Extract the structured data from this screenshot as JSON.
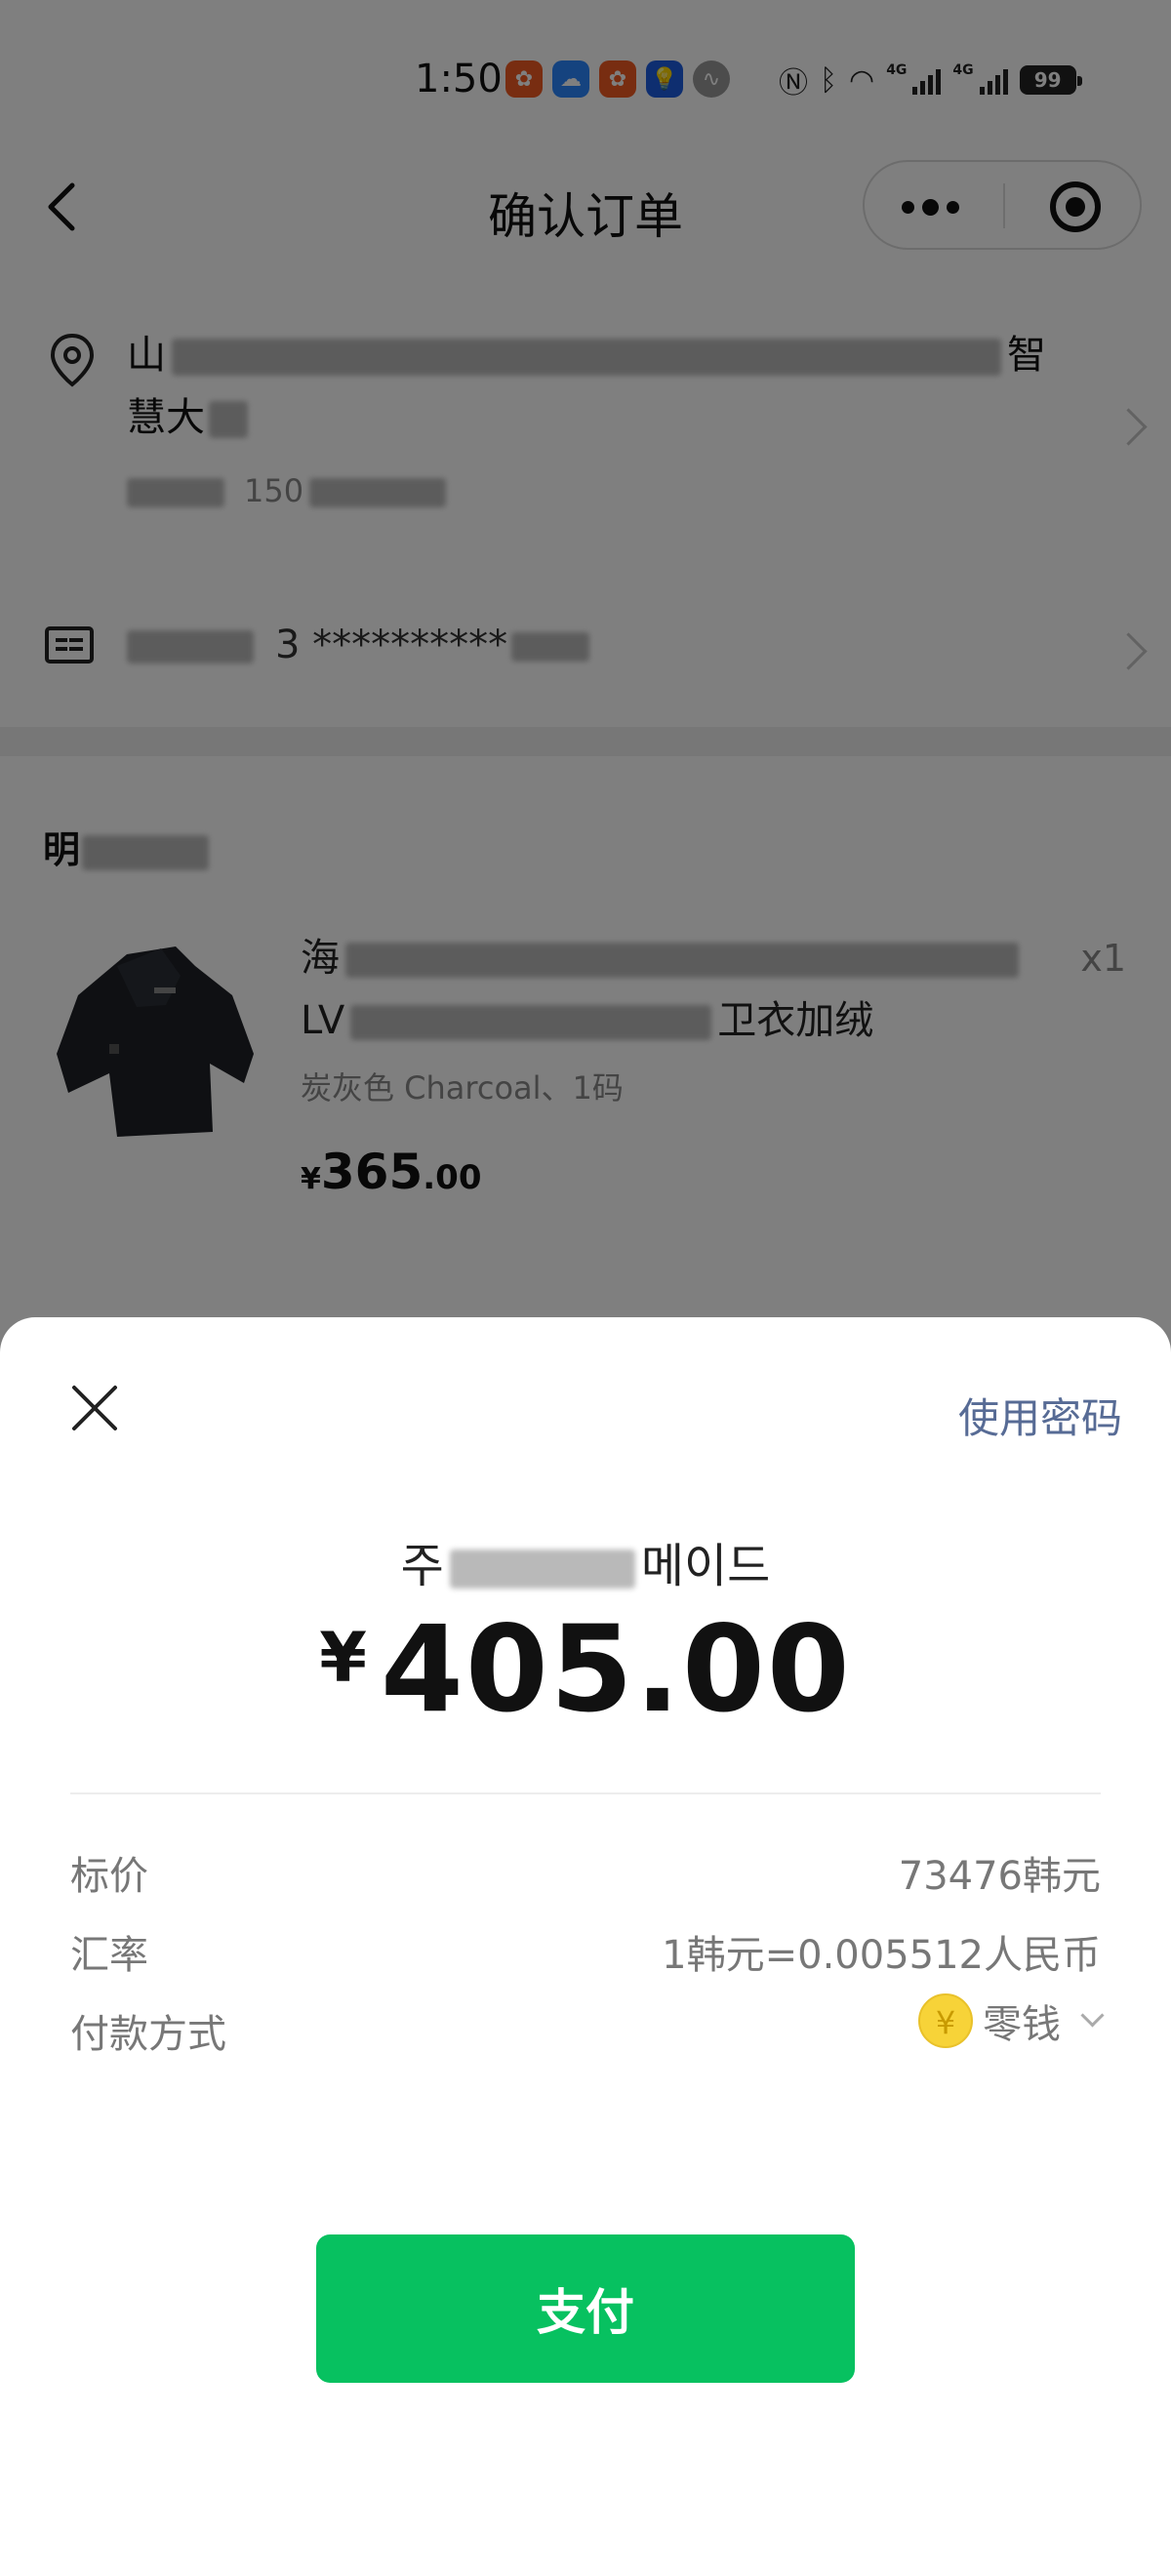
{
  "status_bar": {
    "time": "1:50",
    "app_icons": [
      "app-icon-orange",
      "weather-icon",
      "app-icon-orange",
      "bulb-icon",
      "audio-icon"
    ],
    "net_label_1": "4G",
    "net_label_2": "4G",
    "battery": "99"
  },
  "nav": {
    "title": "确认订单"
  },
  "address": {
    "line1_start": "山",
    "line1_end": "智",
    "line2_start": "慧大",
    "phone_partial": "150"
  },
  "id_card": {
    "masked": "3 **********"
  },
  "shop": {
    "name_start": "明"
  },
  "product": {
    "title_start": "海",
    "title_line2_start": "LV",
    "title_line2_end": "卫衣加绒",
    "spec": "炭灰色 Charcoal、1码",
    "price_currency": "¥",
    "price_int": "365",
    "price_dec": ".00",
    "quantity": "x1"
  },
  "payment_sheet": {
    "use_password": "使用密码",
    "merchant_suffix": "메이드",
    "merchant_start": "주",
    "amount_symbol": "¥",
    "amount": "405.00",
    "rows": [
      {
        "label": "标价",
        "value": "73476韩元"
      },
      {
        "label": "汇率",
        "value": "1韩元=0.005512人民币"
      },
      {
        "label": "付款方式",
        "value": "零钱"
      }
    ],
    "coin_symbol": "¥",
    "pay_button": "支付"
  },
  "colors": {
    "accent_green": "#07c160",
    "link_blue": "#576b95",
    "coin_yellow": "#f7d338"
  }
}
